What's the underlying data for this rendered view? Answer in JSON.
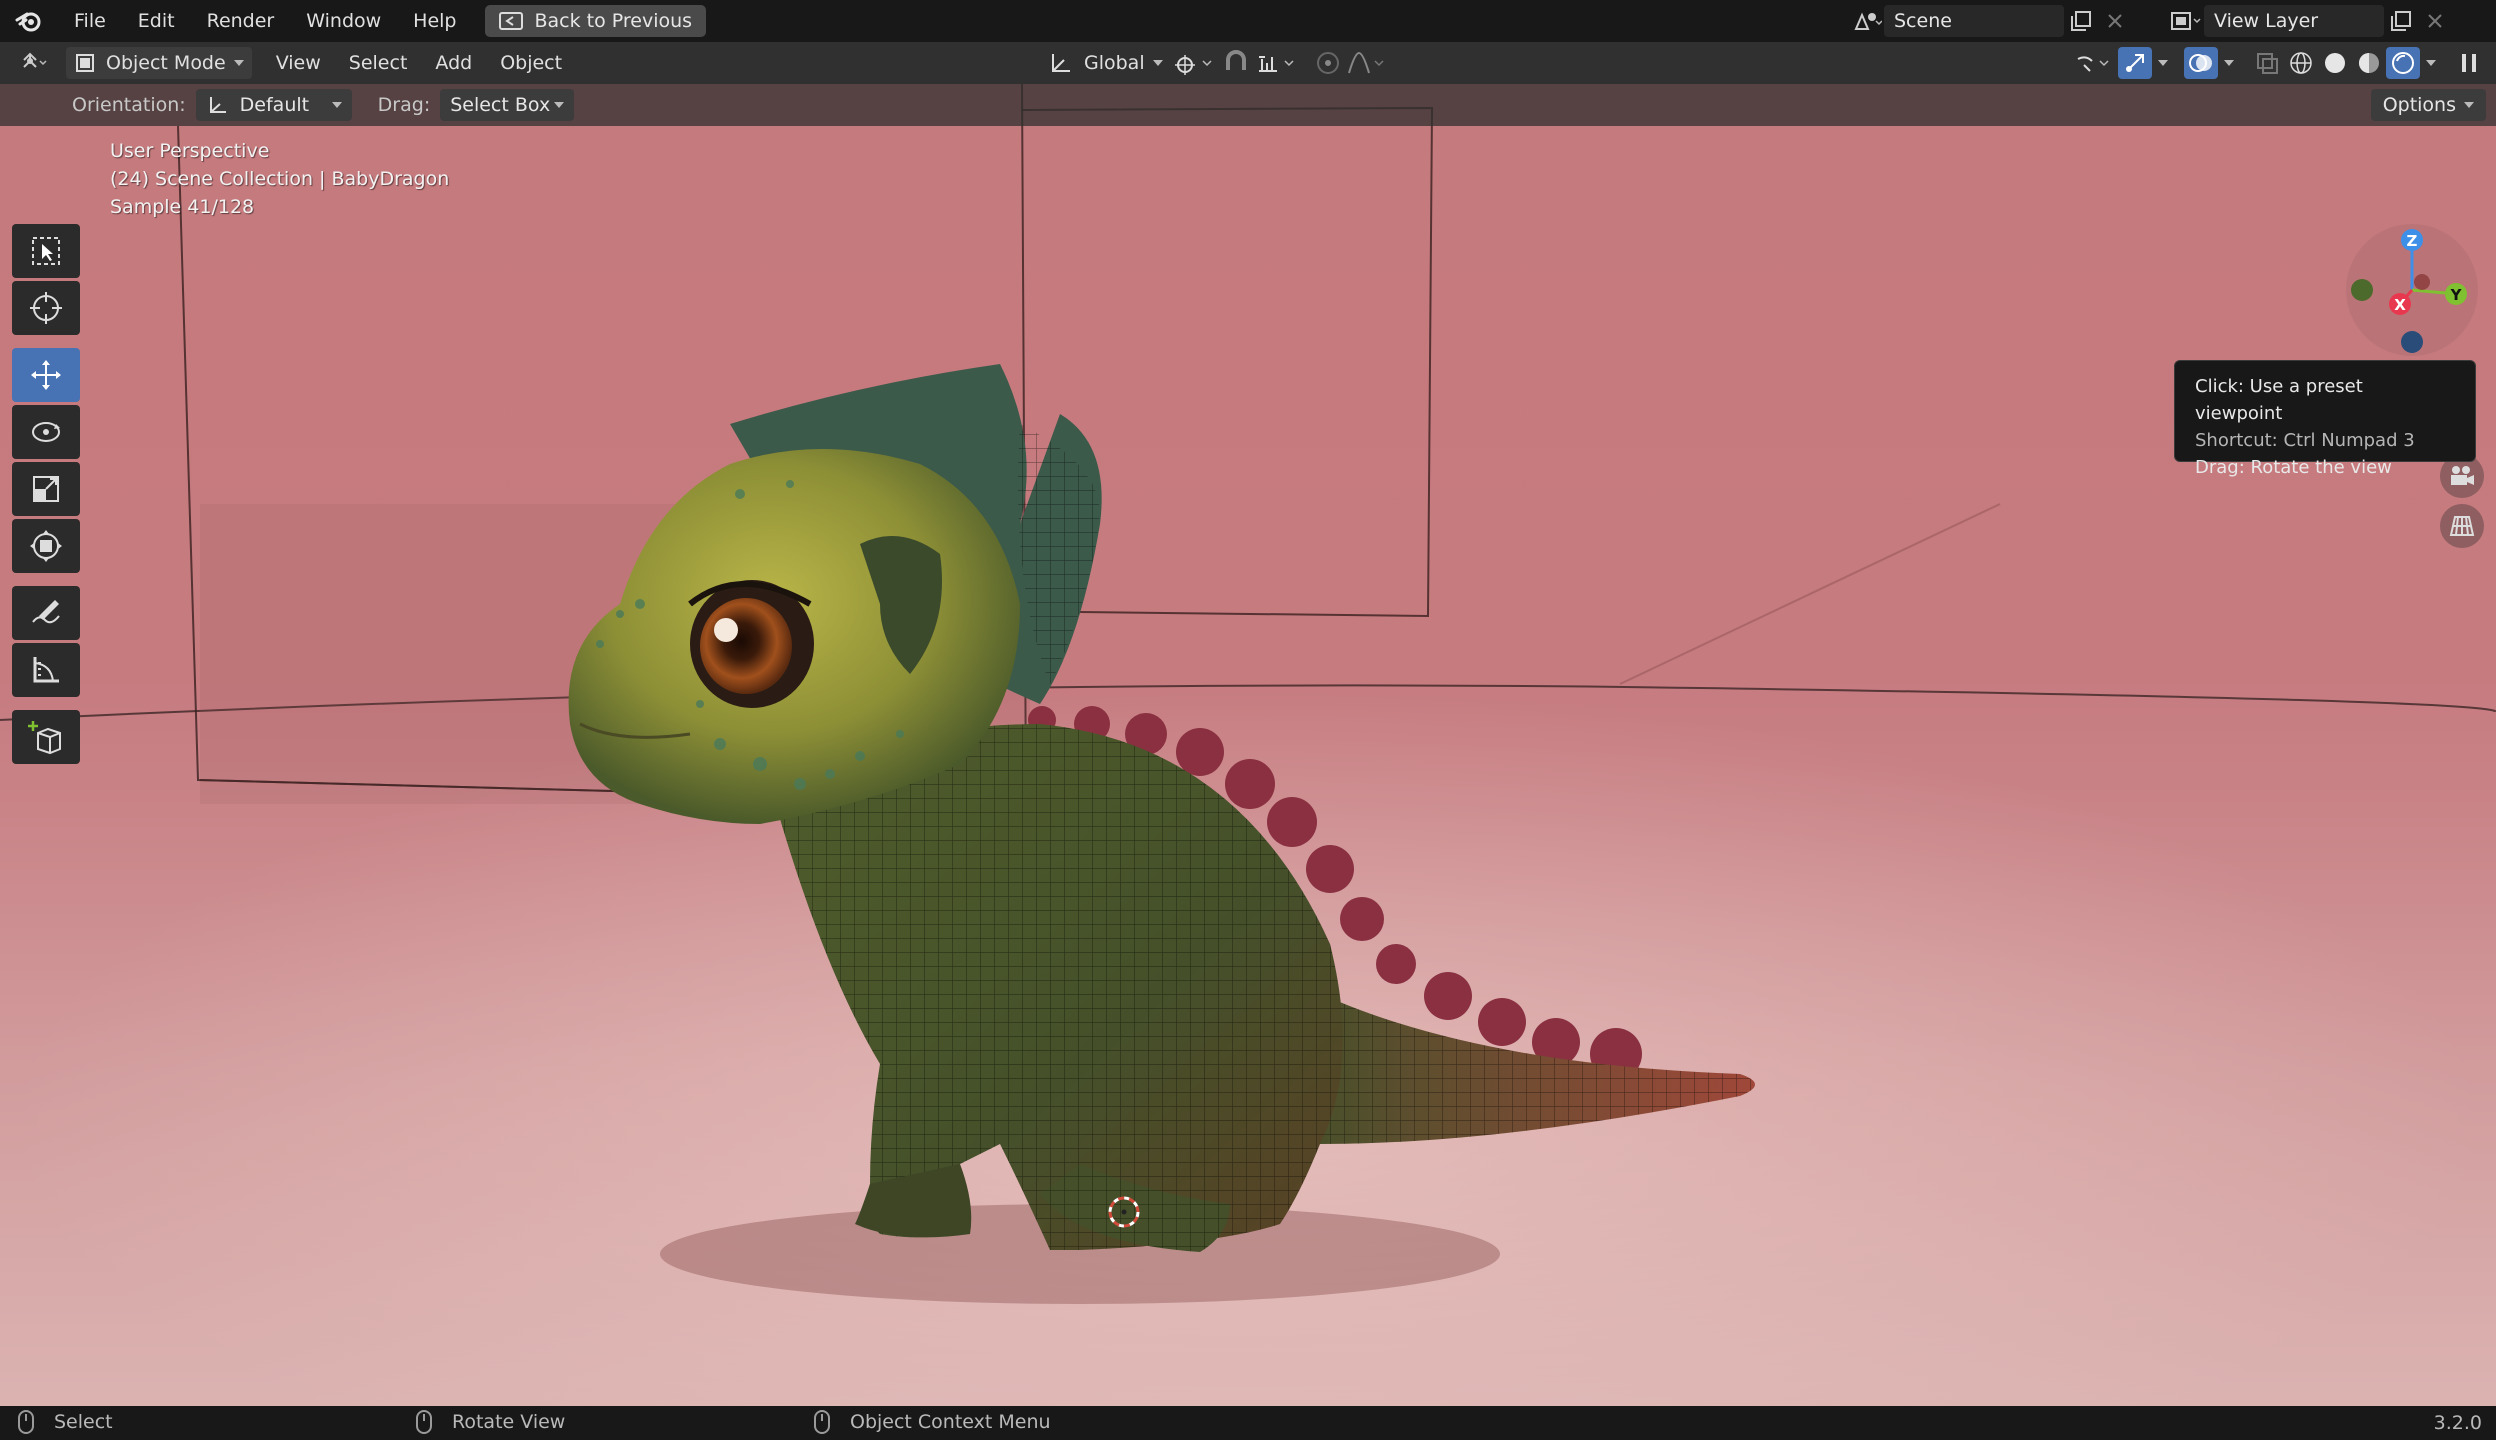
{
  "menubar": {
    "items": [
      "File",
      "Edit",
      "Render",
      "Window",
      "Help"
    ],
    "back_button": "Back to Previous",
    "scene_name": "Scene",
    "view_layer": "View Layer"
  },
  "header": {
    "mode": "Object Mode",
    "menus": [
      "View",
      "Select",
      "Add",
      "Object"
    ],
    "transform_orientation": "Global"
  },
  "tool_settings": {
    "orientation_label": "Orientation:",
    "orientation_value": "Default",
    "drag_label": "Drag:",
    "drag_value": "Select Box",
    "options_label": "Options"
  },
  "viewport": {
    "line1": "User Perspective",
    "line2": "(24) Scene Collection | BabyDragon",
    "line3": "Sample 41/128"
  },
  "gizmo": {
    "z": "Z",
    "x": "X",
    "y": "Y"
  },
  "tooltip": {
    "line1": "Click: Use a preset viewpoint",
    "line2": "Shortcut: Ctrl Numpad 3",
    "line3": "Drag: Rotate the view"
  },
  "statusbar": {
    "select": "Select",
    "rotate": "Rotate View",
    "context": "Object Context Menu",
    "version": "3.2.0"
  },
  "colors": {
    "accent": "#4772b3",
    "background_top": "#c57a7d",
    "axis_x": "#e8384f",
    "axis_y": "#7fc130",
    "axis_z": "#3e8fe8"
  }
}
